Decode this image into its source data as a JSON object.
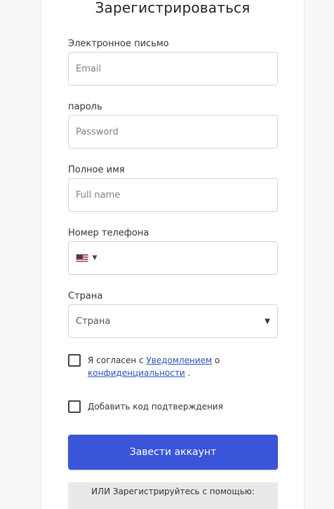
{
  "form": {
    "title": "Зарегистрироваться",
    "email": {
      "label": "Электронное письмо",
      "placeholder": "Email"
    },
    "password": {
      "label": "пароль",
      "placeholder": "Password"
    },
    "fullname": {
      "label": "Полное имя",
      "placeholder": "Full name"
    },
    "phone": {
      "label": "Номер телефона",
      "country_flag": "us-flag-icon",
      "value": ""
    },
    "country": {
      "label": "Страна",
      "selected": "Страна"
    },
    "privacy_checkbox": {
      "prefix": "Я согласен с ",
      "link1": "Уведомлением",
      "middle": " о ",
      "link2": "конфиденциальности",
      "suffix": " ."
    },
    "code_checkbox": {
      "label": "Добавить код подтверждения"
    },
    "submit_label": "Завести аккаунт",
    "or_text": "ИЛИ Зарегистрируйтесь с помощью:"
  },
  "colors": {
    "accent": "#3b55d9",
    "link": "#2c4fb8",
    "or_box_bg": "#e9e9e9"
  }
}
